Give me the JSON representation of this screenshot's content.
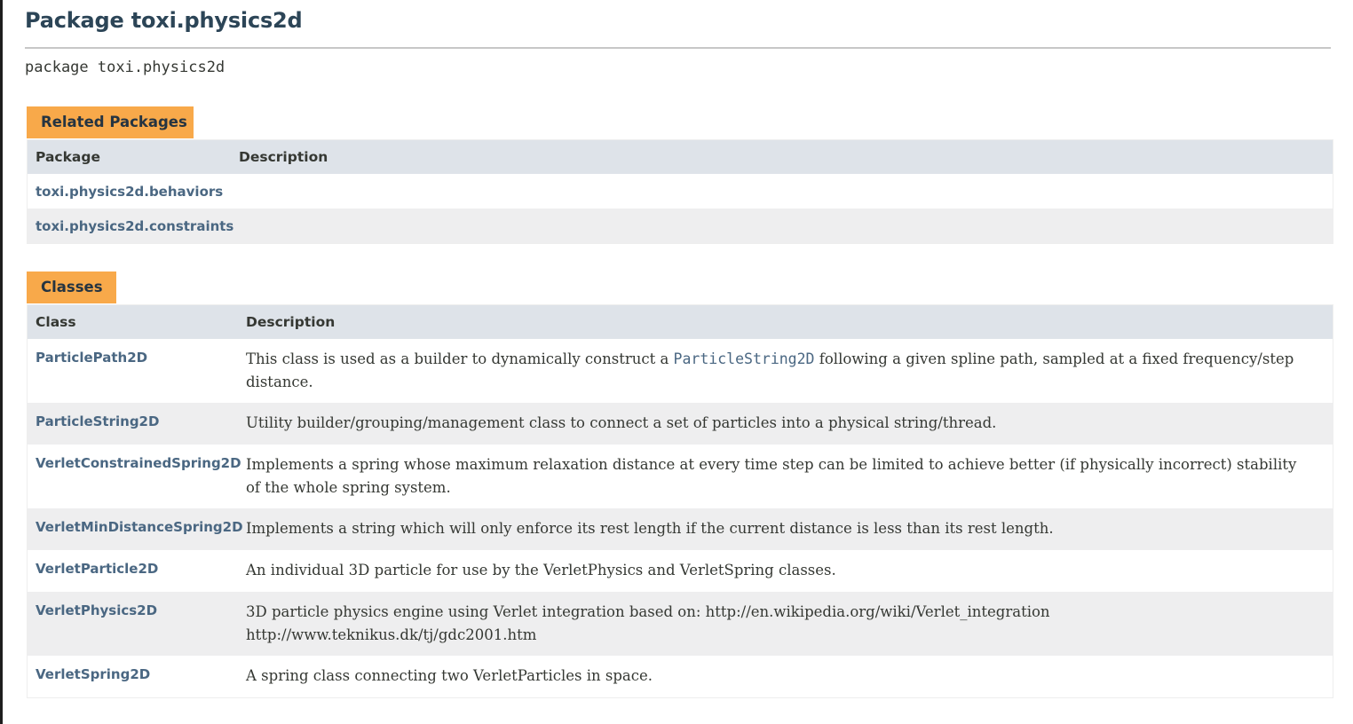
{
  "page": {
    "title": "Package toxi.physics2d",
    "signature": "package toxi.physics2d"
  },
  "related_packages": {
    "tab_label": "Related Packages",
    "headers": {
      "package": "Package",
      "description": "Description"
    },
    "rows": [
      {
        "name": "toxi.physics2d.behaviors",
        "description": ""
      },
      {
        "name": "toxi.physics2d.constraints",
        "description": ""
      }
    ]
  },
  "classes": {
    "tab_label": "Classes",
    "headers": {
      "class": "Class",
      "description": "Description"
    },
    "rows": [
      {
        "name": "ParticlePath2D",
        "desc_before": "This class is used as a builder to dynamically construct a ",
        "desc_code": "ParticleString2D",
        "desc_after": " following a given spline path, sampled at a fixed frequency/step distance."
      },
      {
        "name": "ParticleString2D",
        "description": "Utility builder/grouping/management class to connect a set of particles into a physical string/thread."
      },
      {
        "name": "VerletConstrainedSpring2D",
        "description": "Implements a spring whose maximum relaxation distance at every time step can be limited to achieve better (if physically incorrect) stability of the whole spring system."
      },
      {
        "name": "VerletMinDistanceSpring2D",
        "description": "Implements a string which will only enforce its rest length if the current distance is less than its rest length."
      },
      {
        "name": "VerletParticle2D",
        "description": "An individual 3D particle for use by the VerletPhysics and VerletSpring classes."
      },
      {
        "name": "VerletPhysics2D",
        "desc_line1": "3D particle physics engine using Verlet integration based on: http://en.wikipedia.org/wiki/Verlet_integration",
        "desc_line2": "http://www.teknikus.dk/tj/gdc2001.htm"
      },
      {
        "name": "VerletSpring2D",
        "description": "A spring class connecting two VerletParticles in space."
      }
    ]
  },
  "colors": {
    "tab": "#f8a94a",
    "header_row": "#dee3e9",
    "alt_row": "#eeeeef",
    "link": "#4a6782",
    "title": "#2c4557"
  }
}
